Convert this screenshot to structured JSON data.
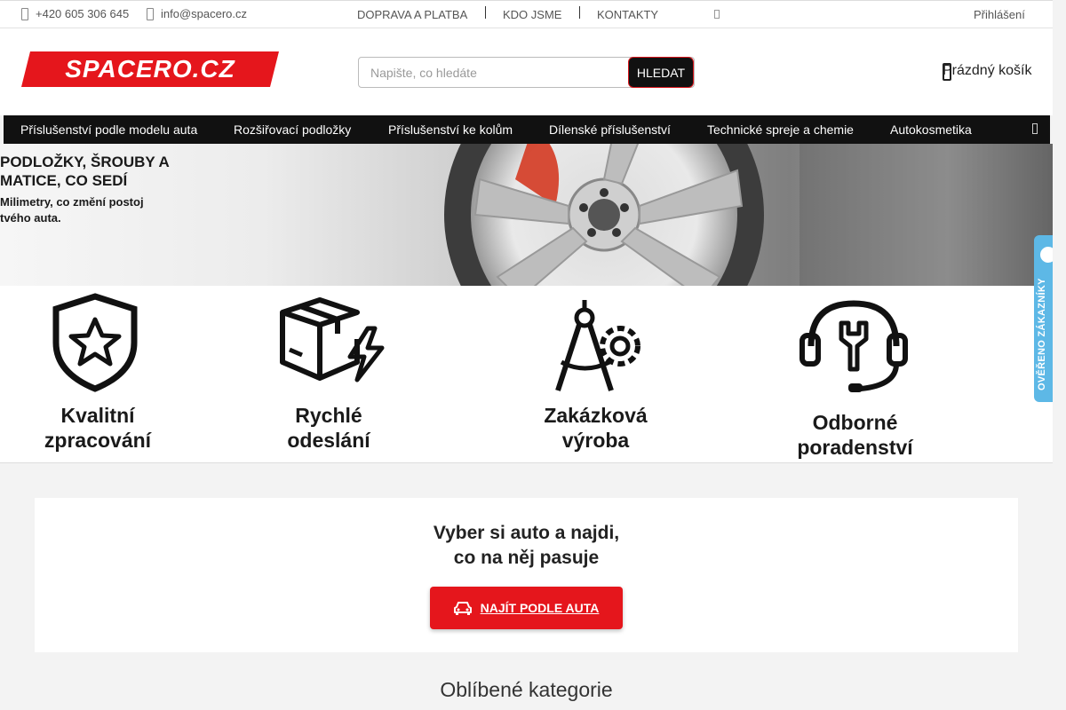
{
  "topbar": {
    "phone": "+420 605 306 645",
    "email": "info@spacero.cz",
    "links": [
      "DOPRAVA A PLATBA",
      "KDO JSME",
      "KONTAKTY"
    ],
    "login": "Přihlášení"
  },
  "header": {
    "logo_text": "SPACERO.CZ",
    "search": {
      "placeholder": "Napište, co hledáte",
      "button_label": "HLEDAT"
    },
    "cart_label": "Prázdný košík"
  },
  "nav": {
    "items": [
      "Příslušenství podle modelu auta",
      "Rozšiřovací podložky",
      "Příslušenství ke kolům",
      "Dílenské příslušenství",
      "Technické spreje a chemie",
      "Autokosmetika"
    ]
  },
  "hero": {
    "title_line1": "PODLOŽKY, ŠROUBY A",
    "title_line2": "MATICE, CO SEDÍ",
    "subtitle_line1": "Milimetry, co změní postoj",
    "subtitle_line2": "tvého auta."
  },
  "benefits": [
    {
      "line1": "Kvalitní",
      "line2": "zpracování",
      "icon": "shield-star-icon"
    },
    {
      "line1": "Rychlé",
      "line2": "odeslání",
      "icon": "box-lightning-icon"
    },
    {
      "line1": "Zakázková",
      "line2": "výroba",
      "icon": "compass-gear-icon"
    },
    {
      "line1": "Odborné",
      "line2": "poradenství",
      "icon": "headset-wrench-icon"
    }
  ],
  "verified_badge": {
    "label": "OVĚŘENO ZÁKAZNÍKY"
  },
  "car_finder": {
    "title_line1": "Vyber si auto a najdi,",
    "title_line2": "co na něj pasuje",
    "button_label": "NAJÍT PODLE AUTA"
  },
  "popular": {
    "title": "Oblíbené kategorie"
  },
  "colors": {
    "brand_red": "#e5161c",
    "nav_bg": "#111111",
    "badge_blue": "#5db8e6"
  }
}
